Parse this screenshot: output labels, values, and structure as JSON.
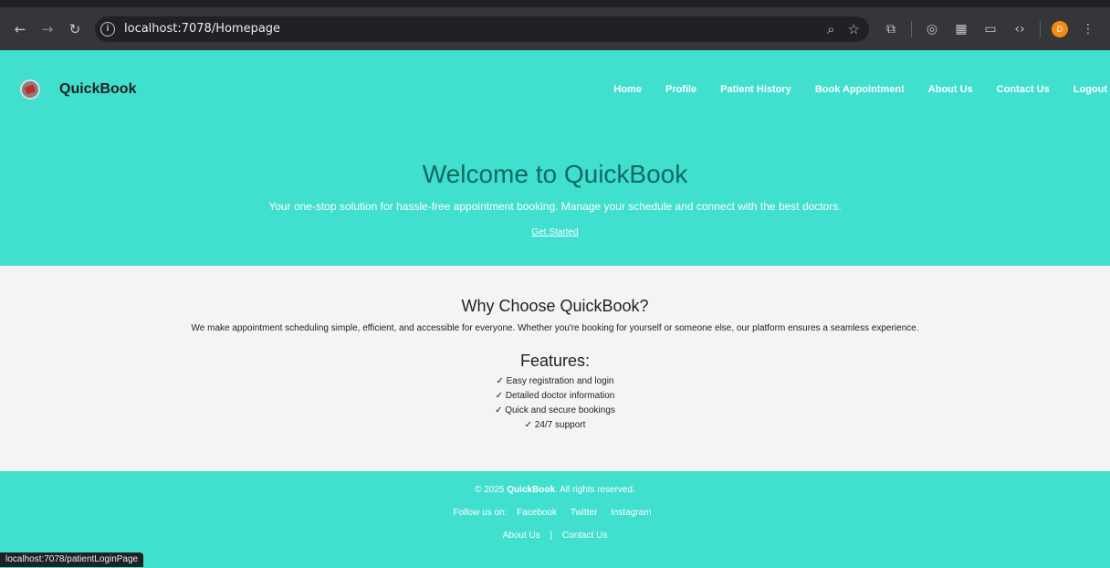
{
  "browser": {
    "url": "localhost:7078/Homepage",
    "avatar_letter": "D",
    "status_url": "localhost:7078/patientLoginPage"
  },
  "site": {
    "brand": "QuickBook",
    "nav": [
      "Home",
      "Profile",
      "Patient History",
      "Book Appointment",
      "About Us",
      "Contact Us",
      "Logout"
    ],
    "hero": {
      "title": "Welcome to QuickBook",
      "subtitle": "Your one-stop solution for hassle-free appointment booking. Manage your schedule and connect with the best doctors.",
      "cta": "Get Started"
    },
    "why": {
      "title": "Why Choose QuickBook?",
      "text": "We make appointment scheduling simple, efficient, and accessible for everyone. Whether you're booking for yourself or someone else, our platform ensures a seamless experience."
    },
    "features": {
      "title": "Features:",
      "items": [
        "✓ Easy registration and login",
        "✓ Detailed doctor information",
        "✓ Quick and secure bookings",
        "✓ 24/7 support"
      ]
    },
    "footer": {
      "copyright_prefix": "© 2025",
      "copyright_brand": "QuickBook",
      "copyright_suffix": ". All rights reserved.",
      "follow_label": "Follow us on:",
      "social": [
        "Facebook",
        "Twitter",
        "Instagram"
      ],
      "about": "About Us",
      "separator": "|",
      "contact": "Contact Us"
    },
    "colors": {
      "primary": "#40dfce",
      "hero_title": "#116a63",
      "content_bg": "#f4f4f4"
    }
  }
}
